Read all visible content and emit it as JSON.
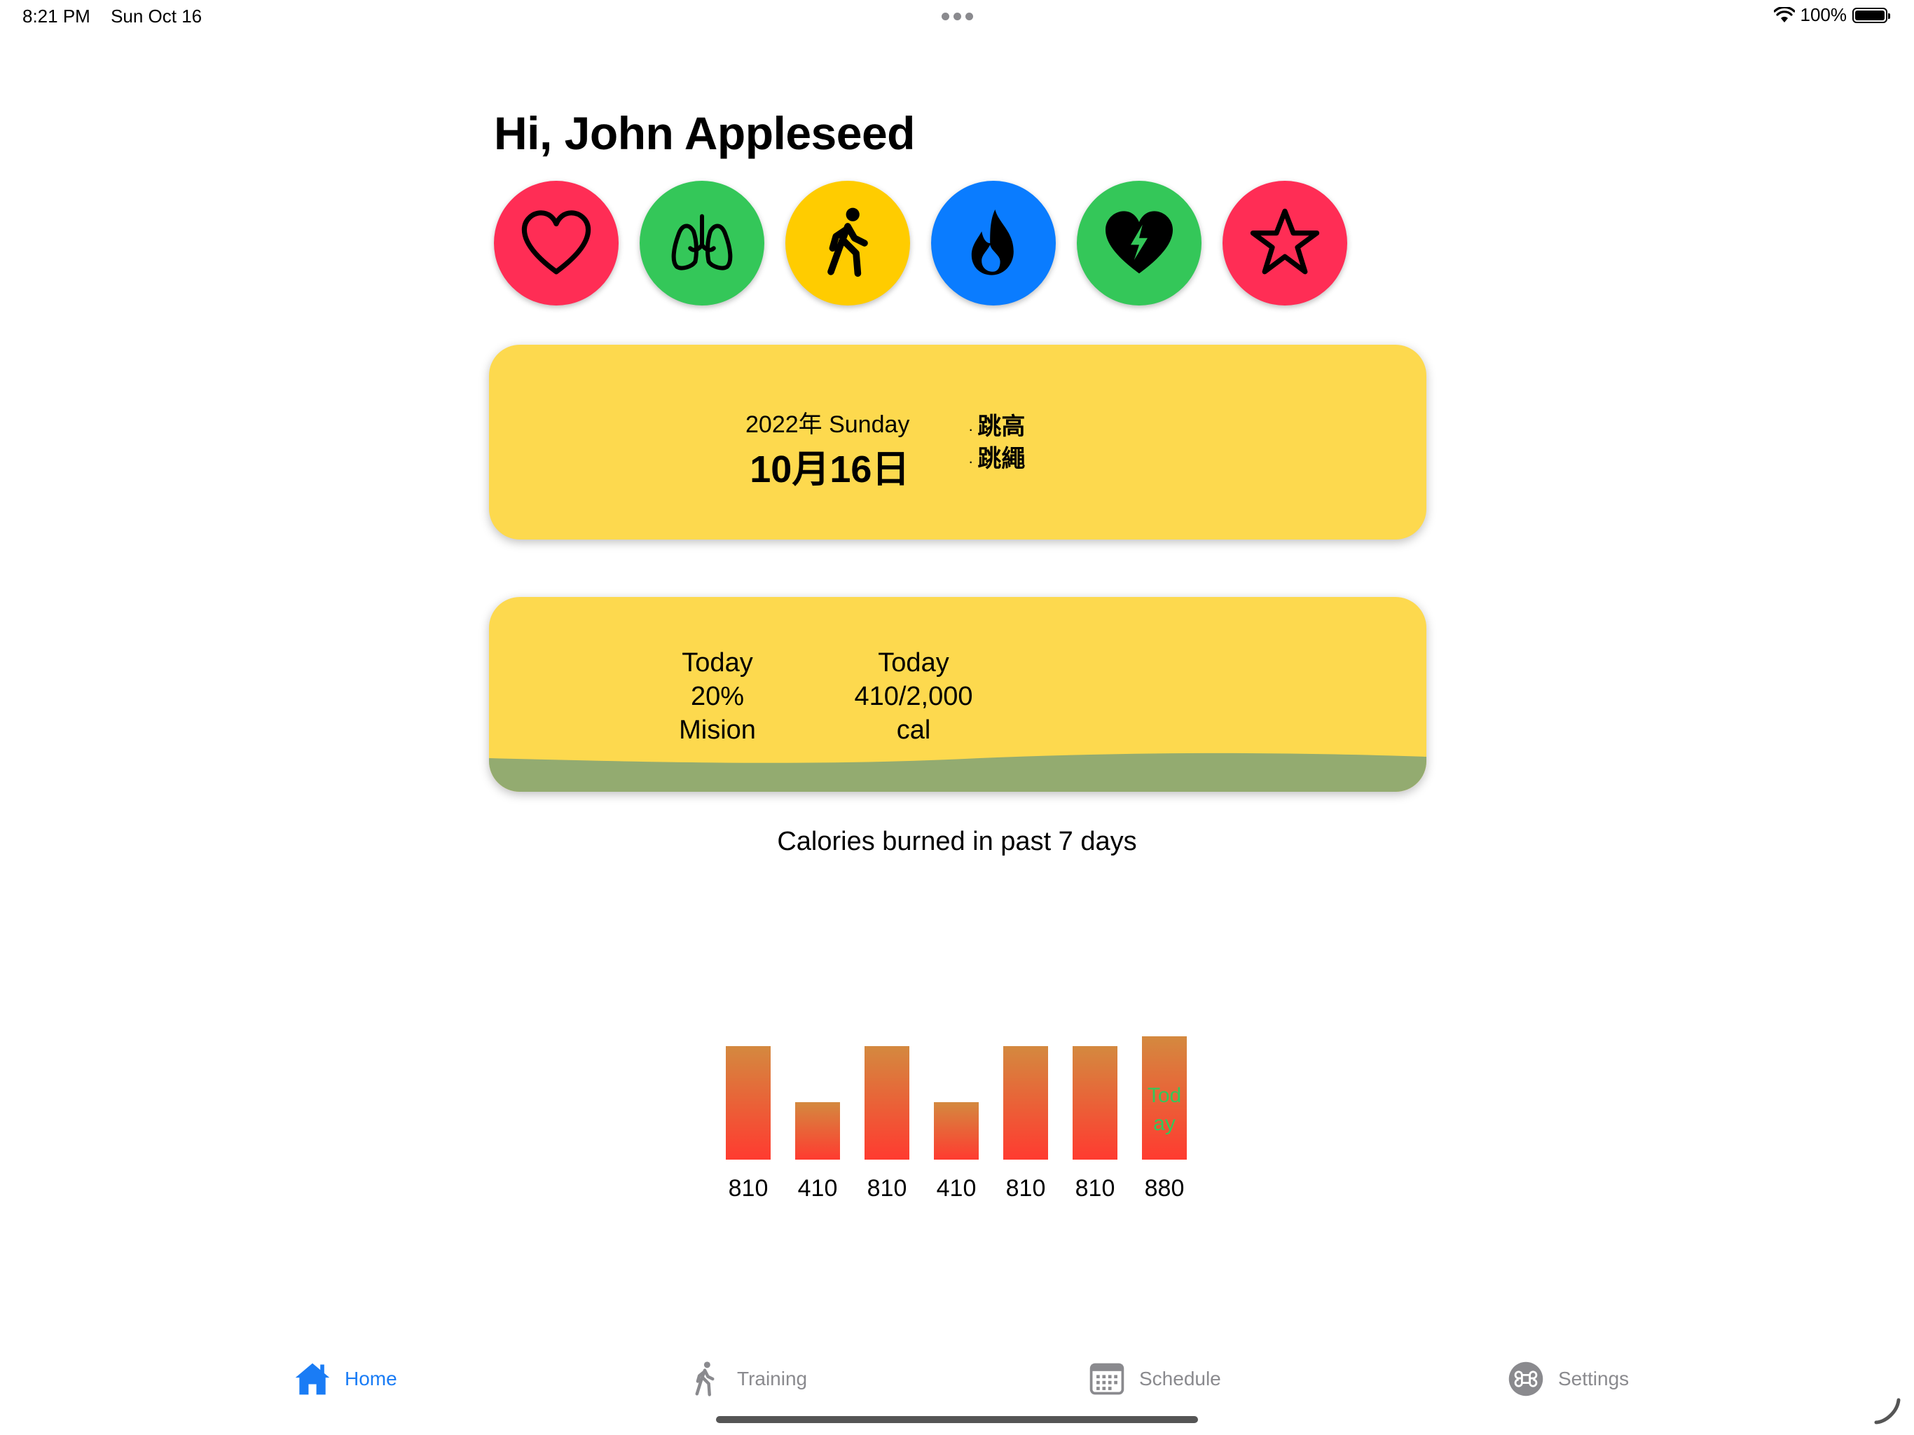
{
  "status_bar": {
    "time": "8:21 PM",
    "date": "Sun Oct 16",
    "battery": "100%",
    "battery_level": 1.0,
    "icons": [
      "more-dots-icon",
      "wifi-icon",
      "battery-icon"
    ]
  },
  "greeting": "Hi, John Appleseed",
  "quick_actions": [
    {
      "icon": "heart-icon",
      "color": "#ff2d55"
    },
    {
      "icon": "lungs-icon",
      "color": "#34c759"
    },
    {
      "icon": "figure-walk-icon",
      "color": "#ffcc00"
    },
    {
      "icon": "flame-icon",
      "color": "#0a7cff"
    },
    {
      "icon": "bolt-heart-icon",
      "color": "#34c759"
    },
    {
      "icon": "star-icon",
      "color": "#ff2d55"
    }
  ],
  "date_card": {
    "year_line": "2022年 Sunday",
    "date_line": "10月16日",
    "events": [
      "跳高",
      "跳繩"
    ],
    "bullet": "·",
    "background": "#fdd94e"
  },
  "mission_card": {
    "left": {
      "line1": "Today",
      "line2": "20%",
      "line3": "Mision"
    },
    "right": {
      "line1": "Today",
      "line2": "410/2,000",
      "line3": "cal"
    },
    "progress": 0.2,
    "wave_color": "#93ab70"
  },
  "chart_title": "Calories burned in past 7 days",
  "chart_data": {
    "type": "bar",
    "values": [
      810,
      410,
      810,
      410,
      810,
      810,
      880
    ],
    "value_labels": [
      "810",
      "410",
      "810",
      "410",
      "810",
      "810",
      "880"
    ],
    "highlight_label": "Today",
    "highlight_index": 6,
    "gradient_top": "#d4893f",
    "gradient_bottom": "#ff3b30",
    "highlight_text_color": "#34c759"
  },
  "tabs": [
    {
      "label": "Home",
      "icon": "house-icon",
      "active": true
    },
    {
      "label": "Training",
      "icon": "figure-walk-icon",
      "active": false
    },
    {
      "label": "Schedule",
      "icon": "calendar-icon",
      "active": false
    },
    {
      "label": "Settings",
      "icon": "command-icon",
      "active": false
    }
  ],
  "accent_color": "#1a7cf5"
}
